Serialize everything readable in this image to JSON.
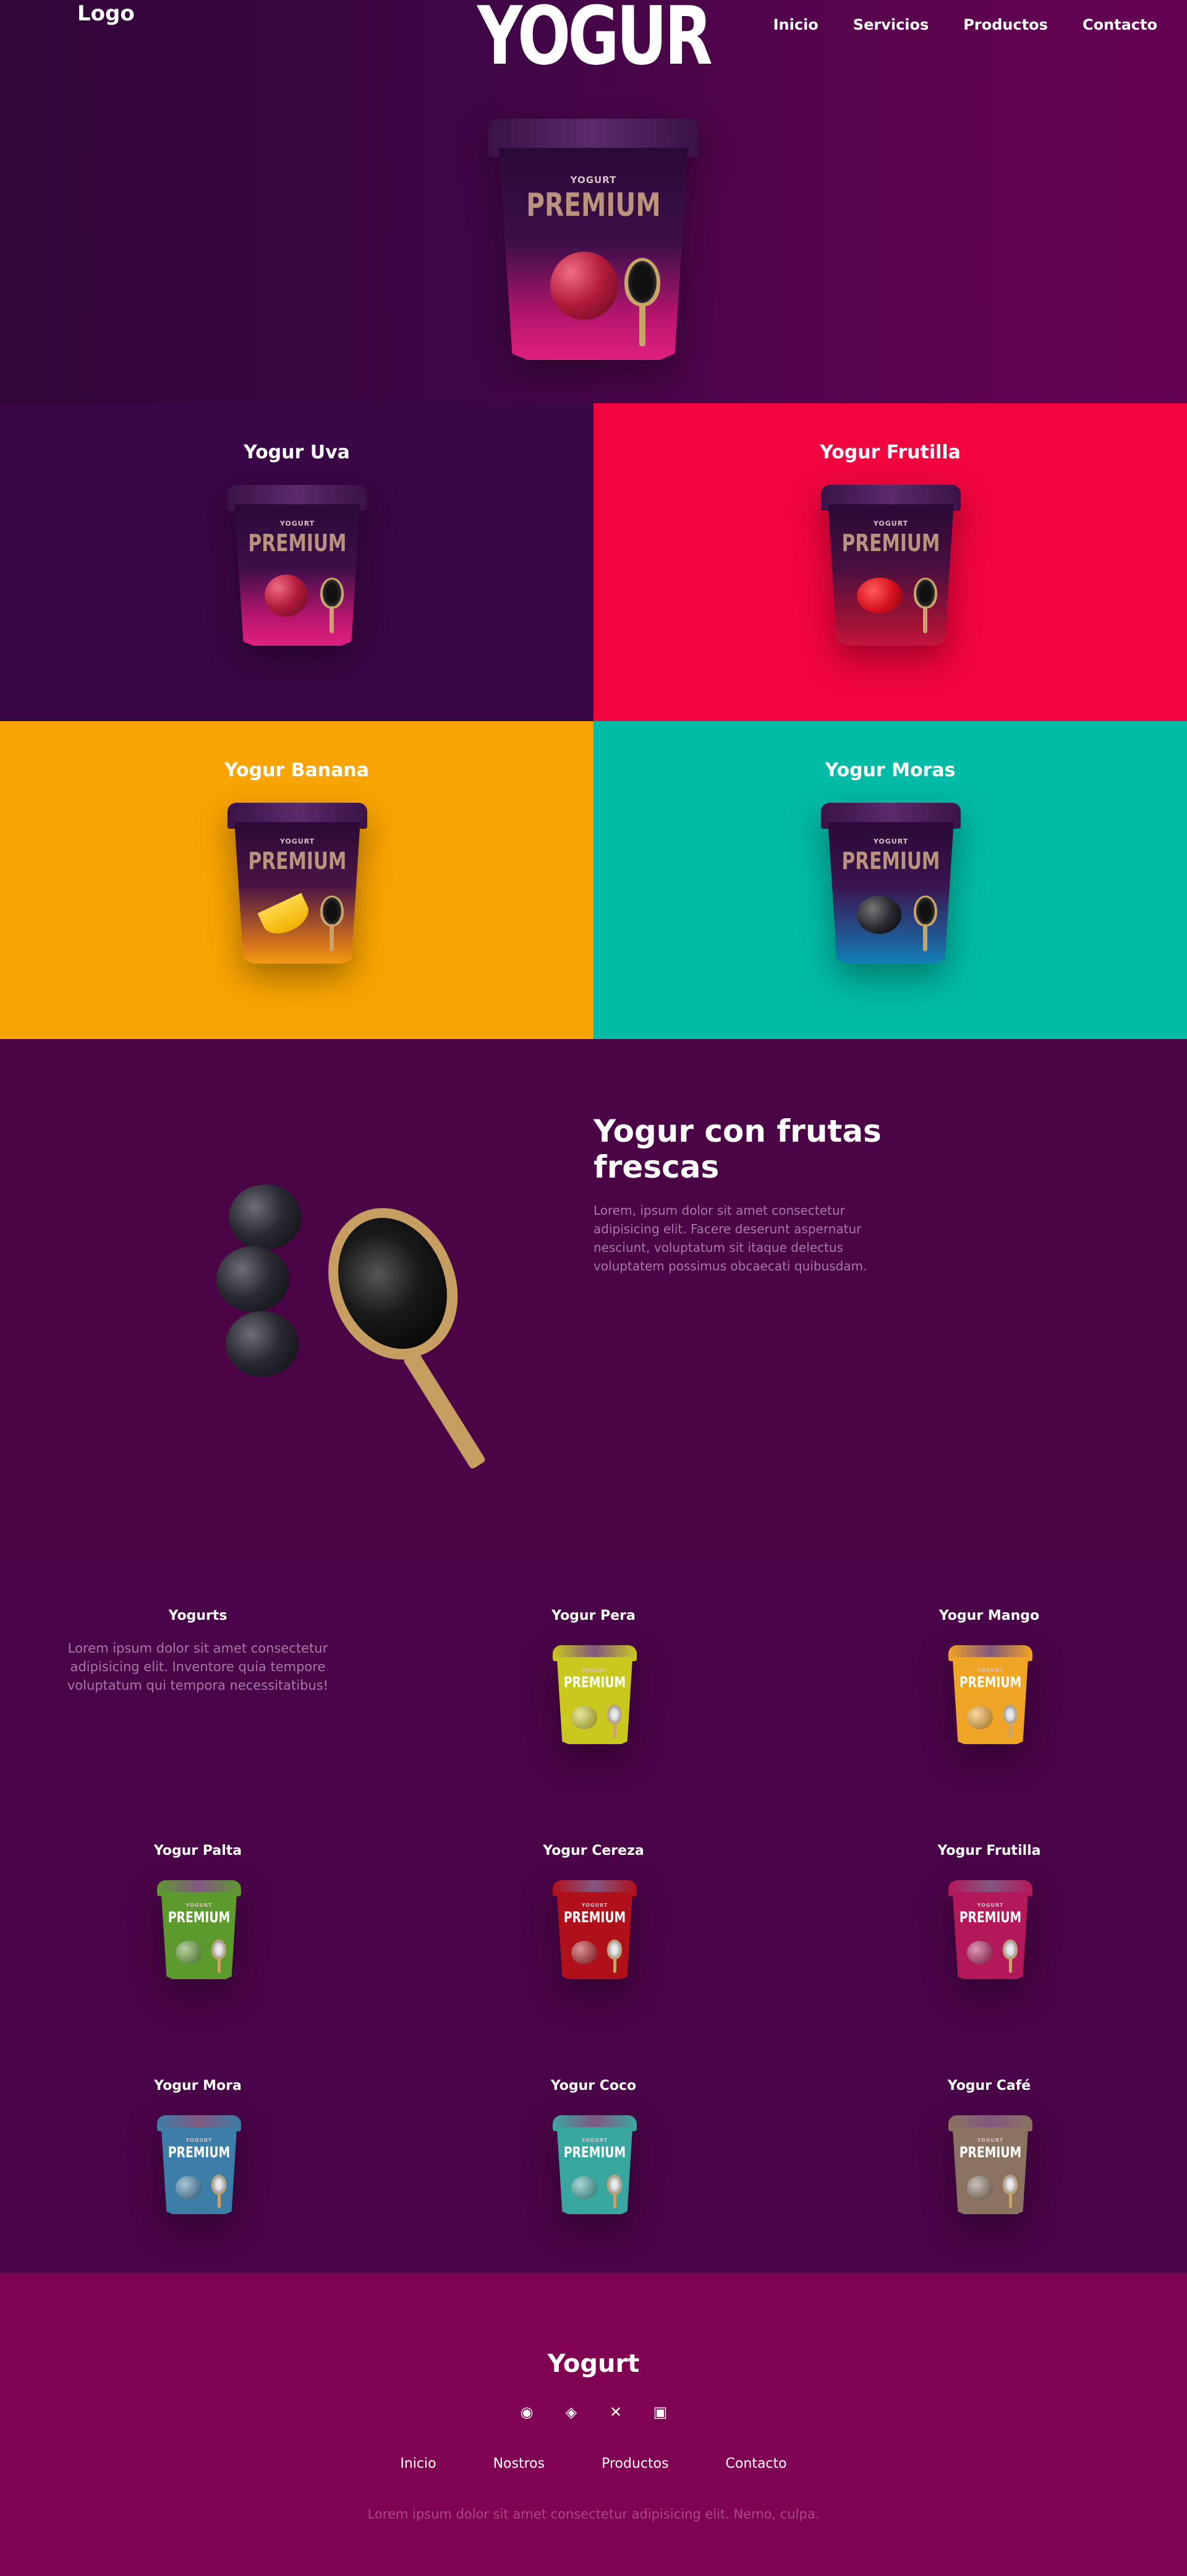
{
  "header": {
    "logo": "Logo",
    "brand": "YOGUR",
    "nav": [
      "Inicio",
      "Servicios",
      "Productos",
      "Contacto"
    ]
  },
  "cup_text": {
    "small": "YOGURT",
    "big": "PREMIUM"
  },
  "featured_products": [
    {
      "name": "Yogur Uva",
      "bg": "#3a0645",
      "fruit": "grape"
    },
    {
      "name": "Yogur Frutilla",
      "bg": "#f2053f",
      "fruit": "strawberry"
    },
    {
      "name": "Yogur Banana",
      "bg": "#f9a400",
      "fruit": "banana"
    },
    {
      "name": "Yogur Moras",
      "bg": "#00bba6",
      "fruit": "blackberry"
    }
  ],
  "feature": {
    "title": "Yogur con frutas frescas",
    "text": "Lorem, ipsum dolor sit amet consectetur adipisicing elit. Facere deserunt aspernatur nesciunt, voluptatum sit itaque delectus voluptatem possimus obcaecati quibusdam."
  },
  "catalog": {
    "title": "Yogurts",
    "text": "Lorem ipsum dolor sit amet consectetur adipisicing elit. Inventore quia tempore voluptatum qui tempora necessitatibus!",
    "items": [
      {
        "name": "Yogur Pera",
        "color": "#c9c81f"
      },
      {
        "name": "Yogur Mango",
        "color": "#f0a424"
      },
      {
        "name": "Yogur Palta",
        "color": "#5c9a2e"
      },
      {
        "name": "Yogur Cereza",
        "color": "#b0101a"
      },
      {
        "name": "Yogur Frutilla",
        "color": "#b3185a"
      },
      {
        "name": "Yogur Mora",
        "color": "#3c7ea8"
      },
      {
        "name": "Yogur Coco",
        "color": "#3aa6a0"
      },
      {
        "name": "Yogur Café",
        "color": "#8a7360"
      }
    ]
  },
  "footer": {
    "brand": "Yogurt",
    "socials": [
      "facebook-icon",
      "instagram-icon",
      "x-icon",
      "linkedin-icon"
    ],
    "nav": [
      "Inicio",
      "Nostros",
      "Productos",
      "Contacto"
    ],
    "text": "Lorem ipsum dolor sit amet consectetur adipisicing elit. Nemo, culpa."
  }
}
